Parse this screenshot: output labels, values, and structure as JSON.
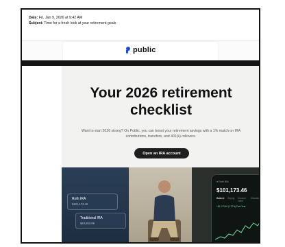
{
  "email": {
    "date_label": "Date:",
    "date_value": "Fri, Jan 9, 2026 at 9:42 AM",
    "subject_label": "Subject:",
    "subject_value": "Time for a fresh look at your retirement goals"
  },
  "brand": {
    "name": "public",
    "color": "#1d4ed8"
  },
  "hero": {
    "title": "Your 2026 retirement checklist",
    "body": "Want to start 2026 strong? On Public, you can boost your retirement savings with a 1% match on IRA contributions, transfers, and 401(k) rollovers.",
    "cta_label": "Open an IRA account"
  },
  "image": {
    "accounts": [
      {
        "name": "Roth IRA",
        "value": "$101,173.46"
      },
      {
        "name": "Traditional IRA",
        "value": "$44,853.89"
      }
    ],
    "phone": {
      "tag": "● Roth IRA",
      "balance": "$101,173.46",
      "tabs": [
        "Balance",
        "Buying",
        "Account value",
        "Allocation"
      ],
      "gain": "+$1,173.46 (1.17%) Past Year"
    }
  },
  "colors": {
    "background": "#ffffff",
    "cta": "#1e1e1e",
    "divider": "#151515",
    "gain": "#6ee7a3"
  }
}
